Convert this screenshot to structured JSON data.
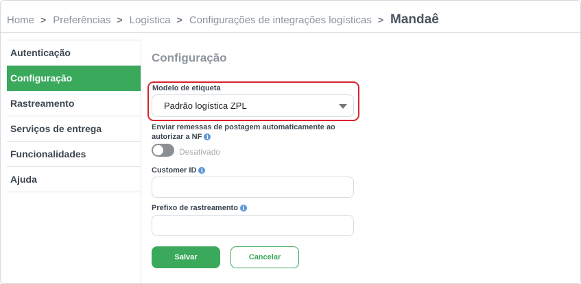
{
  "breadcrumb": {
    "items": [
      "Home",
      "Preferências",
      "Logística",
      "Configurações de integrações logísticas"
    ],
    "current": "Mandaê",
    "separator": ">"
  },
  "sidebar": {
    "items": [
      {
        "label": "Autenticação",
        "active": false
      },
      {
        "label": "Configuração",
        "active": true
      },
      {
        "label": "Rastreamento",
        "active": false
      },
      {
        "label": "Serviços de entrega",
        "active": false
      },
      {
        "label": "Funcionalidades",
        "active": false
      },
      {
        "label": "Ajuda",
        "active": false
      }
    ]
  },
  "main": {
    "title": "Configuração",
    "label_model": "Modelo de etiqueta",
    "label_model_value": "Padrão logística ZPL",
    "auto_send_label": "Enviar remessas de postagem automaticamente ao autorizar a NF",
    "auto_send_state": "Desativado",
    "customer_id_label": "Customer ID",
    "customer_id_value": "",
    "tracking_prefix_label": "Prefixo de rastreamento",
    "tracking_prefix_value": "",
    "info_icon": "i"
  },
  "actions": {
    "save_label": "Salvar",
    "cancel_label": "Cancelar"
  },
  "colors": {
    "accent": "#3aa95c",
    "highlight": "#d9212c",
    "info": "#5b95d6"
  }
}
